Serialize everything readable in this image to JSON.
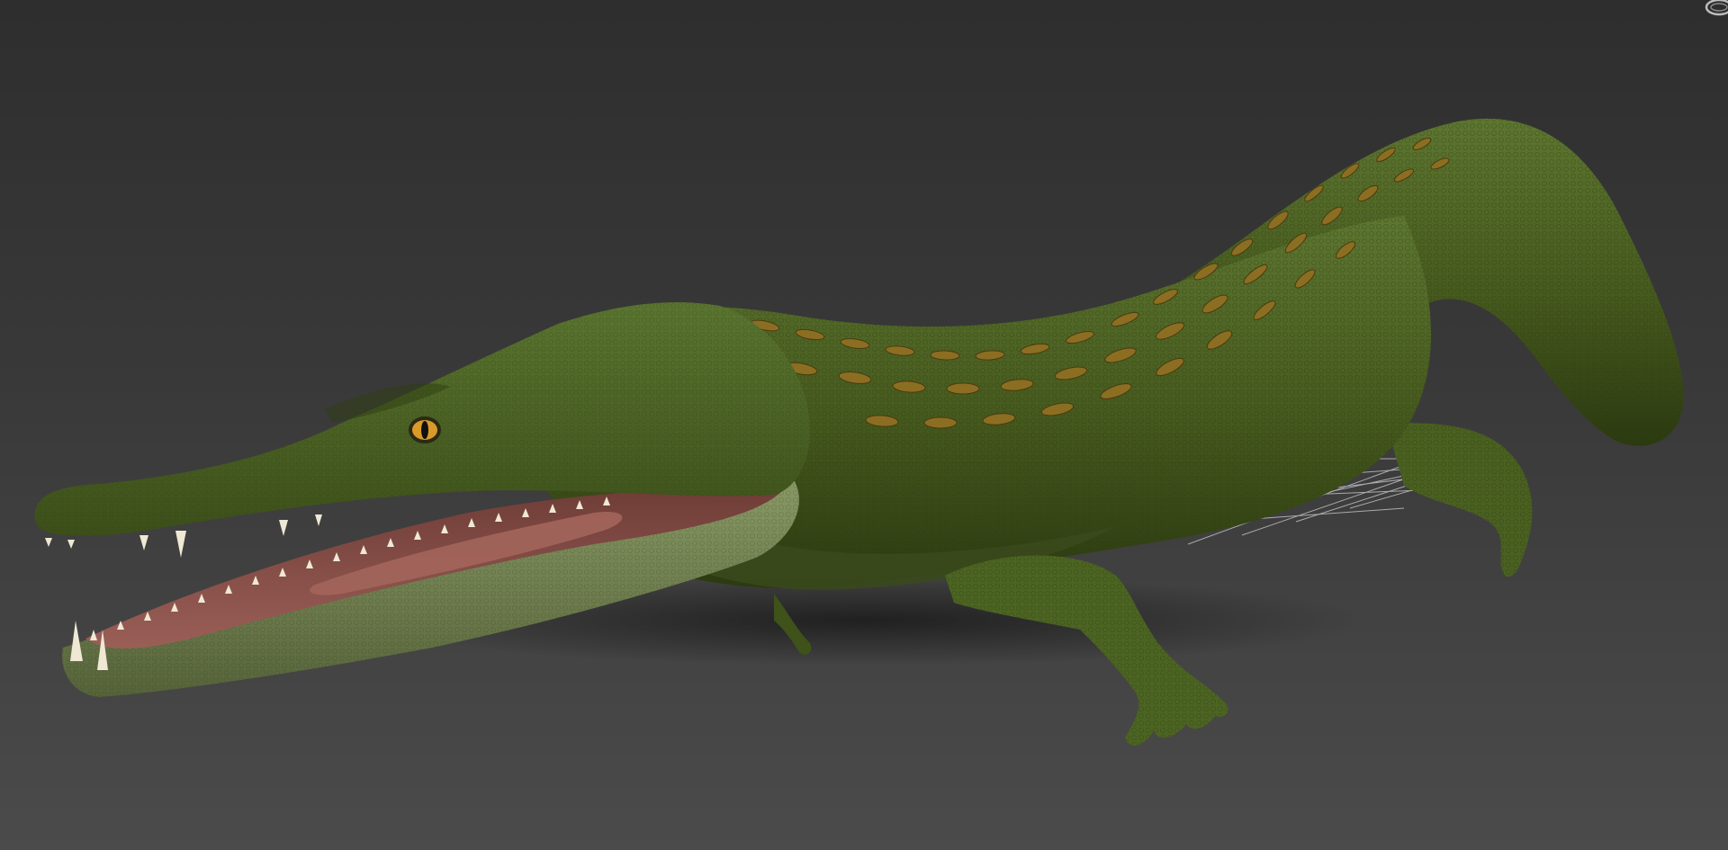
{
  "viewport": {
    "background_top": "#2e2e2e",
    "background_bottom": "#4b4b4b"
  },
  "model": {
    "skin_color": "#4f6624",
    "skin_dark": "#2f3f14",
    "belly_color": "#7c8a58",
    "mouth_color": "#8a4f48",
    "scute_color": "#9a7a26",
    "tooth_color": "#f0ead8",
    "eye_color": "#d99a2a"
  },
  "view_gizmo": {
    "icon": "view-cube-ring-icon"
  }
}
